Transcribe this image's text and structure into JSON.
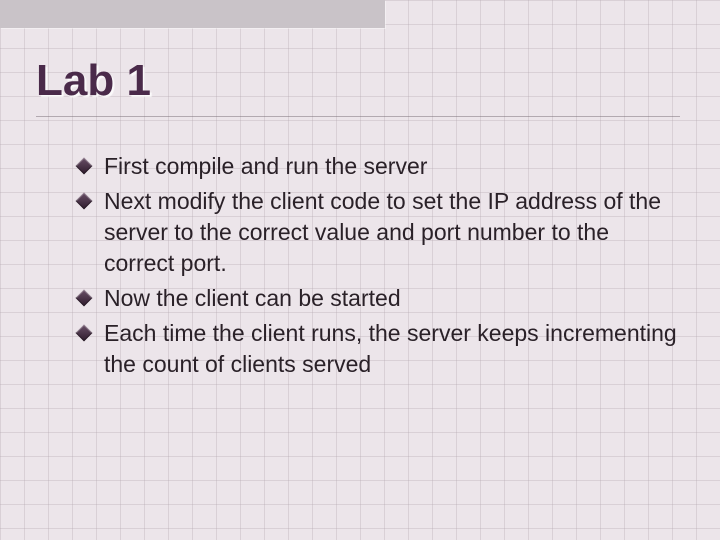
{
  "slide": {
    "title": "Lab 1",
    "bullets": [
      "First compile and run the server",
      "Next modify the client code to set the IP address of the server to the correct value and port number to the correct port.",
      "Now the client can be started",
      "Each time the client runs, the server keeps incrementing the count of clients served"
    ]
  }
}
